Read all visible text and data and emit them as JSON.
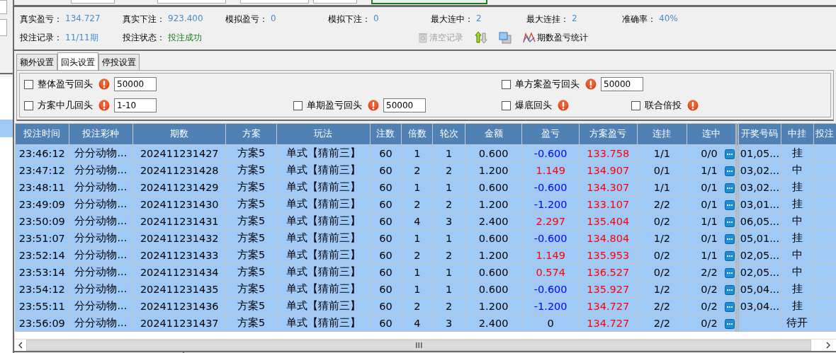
{
  "stats": [
    {
      "label": "真实盈亏：",
      "value": "134.727",
      "color": "#4a8ccb"
    },
    {
      "label": "真实下注：",
      "value": "923.400",
      "color": "#4a8ccb"
    },
    {
      "label": "模拟盈亏：",
      "value": "0",
      "color": "#4a8ccb"
    },
    {
      "label": "模拟下注：",
      "value": "0",
      "color": "#4a8ccb"
    },
    {
      "label": "最大连中：",
      "value": "2",
      "color": "#4a8ccb"
    },
    {
      "label": "最大连挂：",
      "value": "2",
      "color": "#4a8ccb"
    },
    {
      "label": "准确率：",
      "value": "40%",
      "color": "#4a8ccb"
    }
  ],
  "status_row": [
    {
      "label": "投注记录：",
      "value": "11/11期",
      "color": "#4a8ccb"
    },
    {
      "label": "投注状态：",
      "value": "投注成功",
      "color": "#1e7d1e"
    }
  ],
  "toolbar": [
    {
      "kind": "trash",
      "label": "清空记录",
      "disabled": true
    },
    {
      "kind": "sort",
      "disabled": false
    },
    {
      "kind": "windows",
      "disabled": false
    },
    {
      "kind": "chart",
      "label": "期数盈亏统计",
      "disabled": false
    }
  ],
  "tabs": [
    {
      "label": "额外设置",
      "selected": false
    },
    {
      "label": "回头设置",
      "selected": true
    },
    {
      "label": "停投设置",
      "selected": false
    }
  ],
  "settings": [
    {
      "label": "整体盈亏回头",
      "checked": false,
      "value": "50000"
    },
    {
      "label": "单方案盈亏回头",
      "checked": false,
      "value": "50000"
    },
    {
      "label": "方案中几回头",
      "checked": false,
      "value": "1-10"
    },
    {
      "label": "单期盈亏回头",
      "checked": false,
      "value": "50000"
    },
    {
      "label": "爆底回头",
      "checked": false
    },
    {
      "label": "联合倍投",
      "checked": false
    }
  ],
  "table": {
    "columns": [
      "投注时间",
      "投注彩种",
      "期数",
      "方案",
      "玩法",
      "注数",
      "倍数",
      "轮次",
      "金额",
      "盈亏",
      "方案盈亏",
      "连挂",
      "连中",
      "开奖号码",
      "中挂",
      "投注"
    ],
    "rows": [
      {
        "time": "23:46:12",
        "lottery": "分分动物...",
        "issue": "202411231427",
        "plan": "方案5",
        "play": "单式【猜前三】",
        "count": "60",
        "multiple": "1",
        "round": "1",
        "amount": "0.600",
        "profit": "-0.600",
        "color": "#0000ff",
        "plan_profit": "133.758",
        "lose_streak": "1/1",
        "win_streak": "0/0",
        "draw_numbers": "01,05...",
        "result": "挂"
      },
      {
        "time": "23:47:12",
        "lottery": "分分动物...",
        "issue": "202411231428",
        "plan": "方案5",
        "play": "单式【猜前三】",
        "count": "60",
        "multiple": "2",
        "round": "2",
        "amount": "1.200",
        "profit": "1.149",
        "color": "#ff0000",
        "plan_profit": "134.907",
        "lose_streak": "0/1",
        "win_streak": "1/1",
        "draw_numbers": "03,02...",
        "result": "中"
      },
      {
        "time": "23:48:11",
        "lottery": "分分动物...",
        "issue": "202411231429",
        "plan": "方案5",
        "play": "单式【猜前三】",
        "count": "60",
        "multiple": "1",
        "round": "1",
        "amount": "0.600",
        "profit": "-0.600",
        "color": "#0000ff",
        "plan_profit": "134.307",
        "lose_streak": "1/1",
        "win_streak": "0/1",
        "draw_numbers": "03,02...",
        "result": "挂"
      },
      {
        "time": "23:49:09",
        "lottery": "分分动物...",
        "issue": "202411231430",
        "plan": "方案5",
        "play": "单式【猜前三】",
        "count": "60",
        "multiple": "2",
        "round": "2",
        "amount": "1.200",
        "profit": "-1.200",
        "color": "#0000ff",
        "plan_profit": "133.107",
        "lose_streak": "2/2",
        "win_streak": "0/1",
        "draw_numbers": "03,01...",
        "result": "挂"
      },
      {
        "time": "23:50:09",
        "lottery": "分分动物...",
        "issue": "202411231431",
        "plan": "方案5",
        "play": "单式【猜前三】",
        "count": "60",
        "multiple": "4",
        "round": "3",
        "amount": "2.400",
        "profit": "2.297",
        "color": "#ff0000",
        "plan_profit": "135.404",
        "lose_streak": "0/2",
        "win_streak": "1/1",
        "draw_numbers": "06,05...",
        "result": "中"
      },
      {
        "time": "23:51:07",
        "lottery": "分分动物...",
        "issue": "202411231432",
        "plan": "方案5",
        "play": "单式【猜前三】",
        "count": "60",
        "multiple": "1",
        "round": "1",
        "amount": "0.600",
        "profit": "-0.600",
        "color": "#0000ff",
        "plan_profit": "134.804",
        "lose_streak": "1/2",
        "win_streak": "0/1",
        "draw_numbers": "05,01...",
        "result": "挂"
      },
      {
        "time": "23:52:14",
        "lottery": "分分动物...",
        "issue": "202411231433",
        "plan": "方案5",
        "play": "单式【猜前三】",
        "count": "60",
        "multiple": "2",
        "round": "2",
        "amount": "1.200",
        "profit": "1.149",
        "color": "#ff0000",
        "plan_profit": "135.953",
        "lose_streak": "0/2",
        "win_streak": "1/1",
        "draw_numbers": "02,05...",
        "result": "中"
      },
      {
        "time": "23:53:14",
        "lottery": "分分动物...",
        "issue": "202411231434",
        "plan": "方案5",
        "play": "单式【猜前三】",
        "count": "60",
        "multiple": "1",
        "round": "1",
        "amount": "0.600",
        "profit": "0.574",
        "color": "#ff0000",
        "plan_profit": "136.527",
        "lose_streak": "0/2",
        "win_streak": "2/2",
        "draw_numbers": "02,05...",
        "result": "中"
      },
      {
        "time": "23:54:12",
        "lottery": "分分动物...",
        "issue": "202411231435",
        "plan": "方案5",
        "play": "单式【猜前三】",
        "count": "60",
        "multiple": "1",
        "round": "1",
        "amount": "0.600",
        "profit": "-0.600",
        "color": "#0000ff",
        "plan_profit": "135.927",
        "lose_streak": "1/2",
        "win_streak": "0/2",
        "draw_numbers": "05,04...",
        "result": "挂"
      },
      {
        "time": "23:55:11",
        "lottery": "分分动物...",
        "issue": "202411231436",
        "plan": "方案5",
        "play": "单式【猜前三】",
        "count": "60",
        "multiple": "2",
        "round": "2",
        "amount": "1.200",
        "profit": "-1.200",
        "color": "#0000ff",
        "plan_profit": "134.727",
        "lose_streak": "2/2",
        "win_streak": "0/2",
        "draw_numbers": "03,04...",
        "result": "挂"
      },
      {
        "time": "23:56:09",
        "lottery": "分分动物...",
        "issue": "202411231437",
        "plan": "方案5",
        "play": "单式【猜前三】",
        "count": "60",
        "multiple": "4",
        "round": "3",
        "amount": "2.400",
        "profit": "0",
        "color": "#000000",
        "plan_profit": "134.727",
        "lose_streak": "2/2",
        "win_streak": "0/2",
        "result": "待开"
      }
    ]
  }
}
